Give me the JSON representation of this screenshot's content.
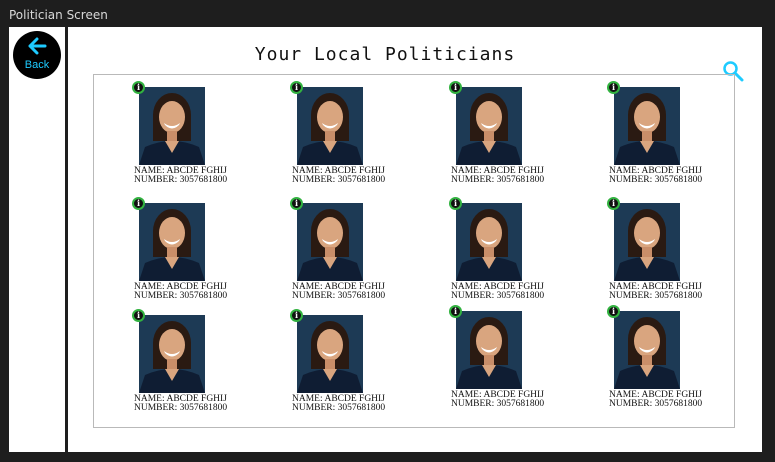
{
  "window": {
    "title": "Politician Screen"
  },
  "sidebar": {
    "back_label": "Back"
  },
  "header": {
    "title": "Your Local Politicians"
  },
  "icons": {
    "back": "arrow-left-icon",
    "search": "search-icon",
    "info": "info-icon"
  },
  "colors": {
    "accent": "#1ecbff",
    "info_ring": "#32b240",
    "photo_bg": "#1d3a55"
  },
  "politicians": [
    {
      "name": "NAME: ABCDE FGHIJ",
      "number": "NUMBER: 3057681800"
    },
    {
      "name": "NAME: ABCDE FGHIJ",
      "number": "NUMBER: 3057681800"
    },
    {
      "name": "NAME: ABCDE FGHIJ",
      "number": "NUMBER: 3057681800"
    },
    {
      "name": "NAME: ABCDE FGHIJ",
      "number": "NUMBER: 3057681800"
    },
    {
      "name": "NAME: ABCDE FGHIJ",
      "number": "NUMBER: 3057681800"
    },
    {
      "name": "NAME: ABCDE FGHIJ",
      "number": "NUMBER: 3057681800"
    },
    {
      "name": "NAME: ABCDE FGHIJ",
      "number": "NUMBER: 3057681800"
    },
    {
      "name": "NAME: ABCDE FGHIJ",
      "number": "NUMBER: 3057681800"
    },
    {
      "name": "NAME: ABCDE FGHIJ",
      "number": "NUMBER: 3057681800"
    },
    {
      "name": "NAME: ABCDE FGHIJ",
      "number": "NUMBER: 3057681800"
    },
    {
      "name": "NAME: ABCDE FGHIJ",
      "number": "NUMBER: 3057681800"
    },
    {
      "name": "NAME: ABCDE FGHIJ",
      "number": "NUMBER: 3057681800"
    }
  ],
  "info_glyph": "i"
}
